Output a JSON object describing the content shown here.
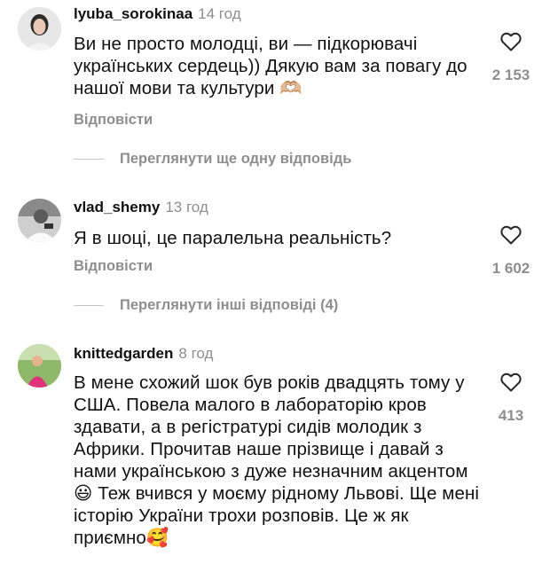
{
  "comments": [
    {
      "username": "lyuba_sorokinaa",
      "time": "14 год",
      "text": "Ви не просто молодці, ви — підкорювачі українських сердець)) Дякую вам за повагу до нашої мови та культури 🫶🏼",
      "reply": "Відповісти",
      "likes": "2 153",
      "view_replies": "Переглянути ще одну відповідь"
    },
    {
      "username": "vlad_shemy",
      "time": "13 год",
      "text": "Я в шоці, це паралельна реальність?",
      "reply": "Відповісти",
      "likes": "1 602",
      "view_replies": "Переглянути інші відповіді (4)"
    },
    {
      "username": "knittedgarden",
      "time": "8 год",
      "text": "В мене схожий шок був років двадцять тому у США. Повела малого в лабораторію кров здавати, а в регістратурі сидів молодик з Африки. Прочитав наше прізвище і давай з нами українською з дуже незначним акцентом 😃 Теж вчився у моєму рідному Львові. Ще мені історію України трохи розповів. Це ж як приємно🥰",
      "likes": "413"
    }
  ],
  "icons": {
    "like": "heart-outline-icon"
  },
  "colors": {
    "secondary_text": "#8e8e8e",
    "primary_text": "#111111"
  }
}
